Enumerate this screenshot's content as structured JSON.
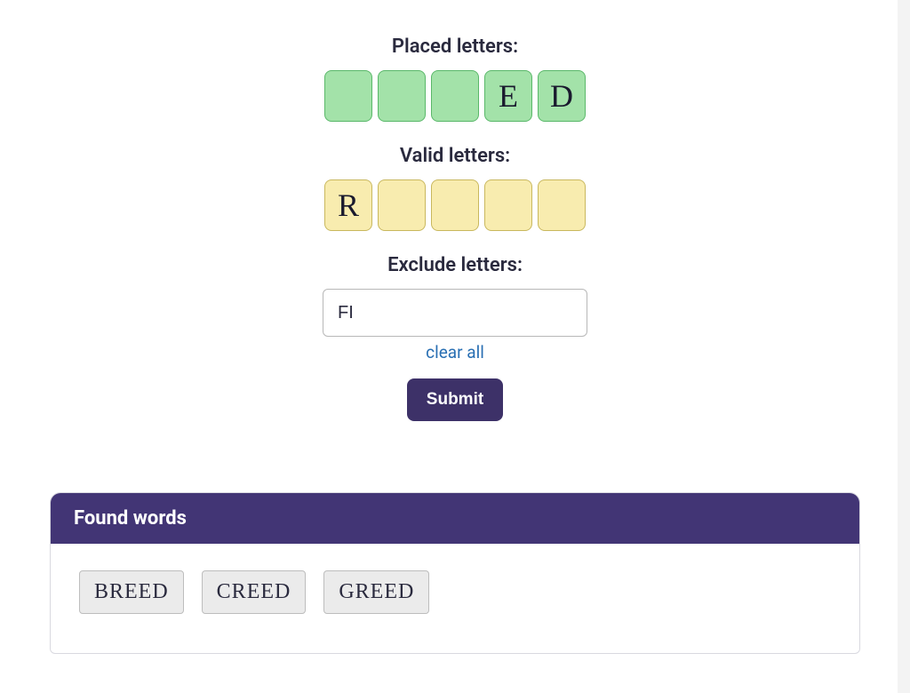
{
  "placed": {
    "label": "Placed letters:",
    "tiles": [
      "",
      "",
      "",
      "E",
      "D"
    ]
  },
  "valid": {
    "label": "Valid letters:",
    "tiles": [
      "R",
      "",
      "",
      "",
      ""
    ]
  },
  "exclude": {
    "label": "Exclude letters:",
    "value": "FI",
    "placeholder": ""
  },
  "actions": {
    "clear": "clear all",
    "submit": "Submit"
  },
  "results": {
    "header": "Found words",
    "words": [
      "BREED",
      "CREED",
      "GREED"
    ]
  }
}
